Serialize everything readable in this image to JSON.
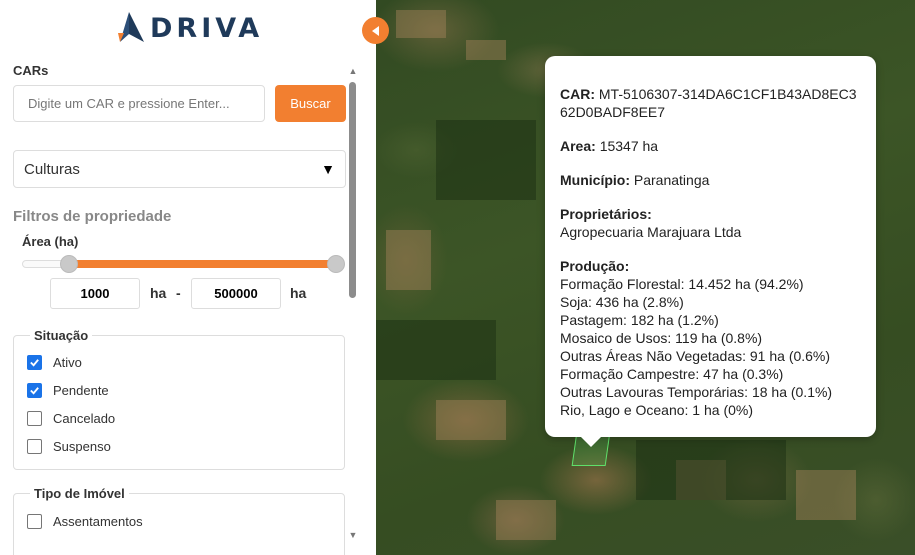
{
  "brand": {
    "name": "DRIVA",
    "logo_icon": "paper-plane-icon"
  },
  "cars": {
    "title": "CARs",
    "search_placeholder": "Digite um CAR e pressione Enter...",
    "search_button": "Buscar"
  },
  "culturas": {
    "label": "Culturas",
    "arrow": "▼"
  },
  "filtros": {
    "title": "Filtros de propriedade",
    "area_label": "Área (ha)",
    "area_min": "1000",
    "area_max": "500000",
    "unit": "ha",
    "separator": "-"
  },
  "situacao": {
    "title": "Situação",
    "options": [
      {
        "label": "Ativo",
        "checked": true
      },
      {
        "label": "Pendente",
        "checked": true
      },
      {
        "label": "Cancelado",
        "checked": false
      },
      {
        "label": "Suspenso",
        "checked": false
      }
    ]
  },
  "tipo_imovel": {
    "title": "Tipo de Imóvel",
    "options": [
      {
        "label": "Assentamentos",
        "checked": false
      }
    ]
  },
  "popup": {
    "car_label": "CAR:",
    "car_value": "MT-5106307-314DA6C1CF1B43AD8EC362D0BADF8EE7",
    "area_label": "Area:",
    "area_value": "15347 ha",
    "municipio_label": "Município:",
    "municipio_value": "Paranatinga",
    "proprietarios_label": "Proprietários:",
    "proprietarios_value": "Agropecuaria Marajuara Ltda",
    "producao_label": "Produção:",
    "producao_items": [
      "Formação Florestal: 14.452 ha (94.2%)",
      "Soja: 436 ha (2.8%)",
      "Pastagem: 182 ha (1.2%)",
      "Mosaico de Usos: 119 ha (0.8%)",
      "Outras Áreas Não Vegetadas: 91 ha (0.6%)",
      "Formação Campestre: 47 ha (0.3%)",
      "Outras Lavouras Temporárias: 18 ha (0.1%)",
      "Rio, Lago e Oceano: 1 ha (0%)"
    ]
  },
  "colors": {
    "accent": "#f27f30",
    "brand": "#1f3a5a",
    "checkbox": "#1a73e8"
  }
}
